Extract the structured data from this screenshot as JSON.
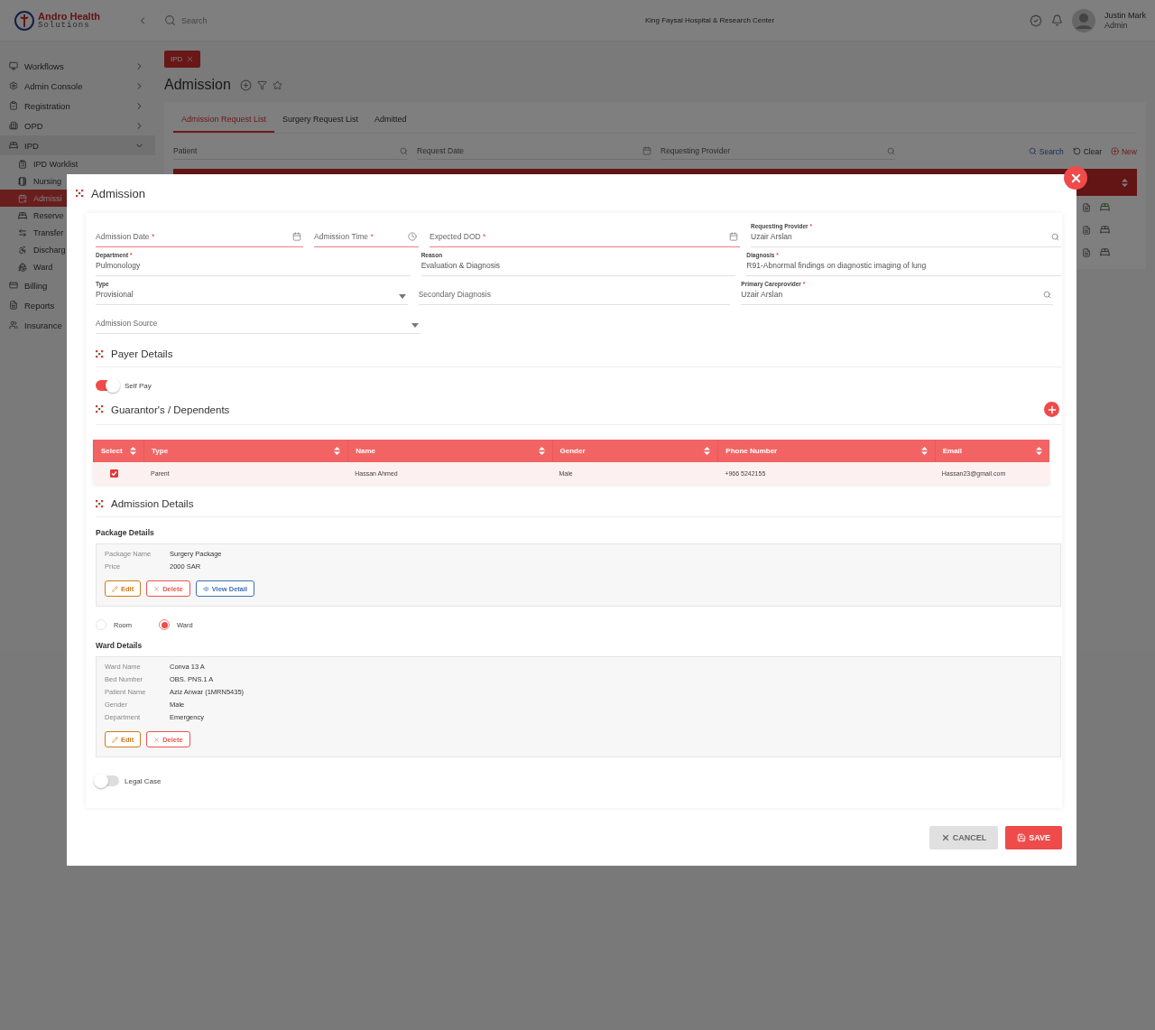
{
  "header": {
    "logo": {
      "name": "Andro Health",
      "tagline": "Solutions"
    },
    "search": {
      "placeholder": "Search"
    },
    "organization": "King Faysal Hospital & Research Center",
    "user": {
      "name": "Justin Mark",
      "role": "Admin"
    }
  },
  "sidebar": {
    "items": [
      {
        "label": "Workflows",
        "kind": "group",
        "expanded": false
      },
      {
        "label": "Admin Console",
        "kind": "group",
        "expanded": false
      },
      {
        "label": "Registration",
        "kind": "group",
        "expanded": false
      },
      {
        "label": "OPD",
        "kind": "group",
        "expanded": false
      },
      {
        "label": "IPD",
        "kind": "group",
        "expanded": true,
        "children": [
          {
            "label": "IPD Worklist",
            "selected": false
          },
          {
            "label": "Nursing",
            "selected": false
          },
          {
            "label": "Admissi",
            "selected": true
          },
          {
            "label": "Reserve",
            "selected": false
          },
          {
            "label": "Transfer",
            "selected": false
          },
          {
            "label": "Discharg",
            "selected": false
          },
          {
            "label": "Ward",
            "selected": false
          }
        ]
      },
      {
        "label": "Billing",
        "kind": "link"
      },
      {
        "label": "Reports",
        "kind": "link"
      },
      {
        "label": "Insurance",
        "kind": "link"
      }
    ]
  },
  "breadcrumb": {
    "label": "IPD"
  },
  "page_title": "Admission",
  "tabs": [
    {
      "label": "Admission Request List",
      "selected": true
    },
    {
      "label": "Surgery Request List",
      "selected": false
    },
    {
      "label": "Admitted",
      "selected": false
    }
  ],
  "filters": [
    {
      "placeholder": "Patient",
      "kind": "lookup"
    },
    {
      "placeholder": "Request Date",
      "kind": "date"
    },
    {
      "placeholder": "Requesting Provider",
      "kind": "lookup"
    }
  ],
  "filter_actions": [
    {
      "label": "Search",
      "kind": "search"
    },
    {
      "label": "Clear",
      "kind": "clear"
    },
    {
      "label": "New",
      "kind": "new"
    }
  ],
  "modal": {
    "title": "Admission",
    "field_rows": [
      [
        {
          "label": "Admission Date",
          "required_mark": "*",
          "kind": "date"
        },
        {
          "label": "Admission Time",
          "required_mark": "*",
          "kind": "time"
        },
        {
          "label": "Expected DOD",
          "required_mark": "*",
          "kind": "date"
        },
        {
          "label": "Requesting Provider",
          "required_mark": "*",
          "kind": "lookup",
          "value": "Uzair Arslan"
        }
      ],
      [
        {
          "label": "Department",
          "required_mark": "*",
          "kind": "text",
          "value": "Pulmonology"
        },
        {
          "label": "Reason",
          "kind": "text",
          "value": "Evaluation & Diagnosis"
        },
        {
          "label": "Diagnosis",
          "required_mark": "*",
          "kind": "text",
          "value": "R91-Abnormal findings on diagnostic imaging of lung"
        }
      ],
      [
        {
          "label": "Type",
          "kind": "select",
          "value": "Provisional"
        },
        {
          "label": "Secondary Diagnosis",
          "kind": "text"
        },
        {
          "label": "Primary Careprovider",
          "required_mark": "*",
          "kind": "lookup",
          "value": "Uzair Arslan"
        }
      ],
      [
        {
          "label": "Admission Source",
          "kind": "select"
        }
      ]
    ],
    "payer": {
      "title": "Payer Details",
      "self_pay": {
        "label": "Self Pay",
        "on": true
      }
    },
    "guarantors": {
      "title": "Guarantor's / Dependents",
      "columns": [
        "Select",
        "Type",
        "Name",
        "Gender",
        "Phone Number",
        "Email"
      ],
      "rows": [
        {
          "checked": true,
          "cells": [
            "",
            "Parent",
            "Hassan Ahmed",
            "Male",
            "+966 5242155",
            "Hassan23@gmail.com"
          ]
        }
      ]
    },
    "admission_details": {
      "title": "Admission Details",
      "package": {
        "heading": "Package Details",
        "fields": [
          {
            "label": "Package Name",
            "value": "Surgery Package"
          },
          {
            "label": "Price",
            "value": "2000 SAR"
          }
        ],
        "actions": [
          {
            "label": "Edit",
            "kind": "edit"
          },
          {
            "label": "Delete",
            "kind": "delete"
          },
          {
            "label": "View Detail",
            "kind": "view"
          }
        ]
      },
      "accommodation": [
        {
          "label": "Room",
          "selected": false
        },
        {
          "label": "Ward",
          "selected": true
        }
      ],
      "ward": {
        "heading": "Ward Details",
        "fields": [
          {
            "label": "Ward Name",
            "value": "Conva 13 A"
          },
          {
            "label": "Bed Number",
            "value": "OBS. PNS.1 A"
          },
          {
            "label": "Patient Name",
            "value": "Aziz Anwar (1MRN5435)"
          },
          {
            "label": "Gender",
            "value": "Male"
          },
          {
            "label": "Department",
            "value": "Emergency"
          }
        ],
        "actions": [
          {
            "label": "Edit",
            "kind": "edit"
          },
          {
            "label": "Delete",
            "kind": "delete"
          }
        ]
      },
      "legal_case": {
        "label": "Legal Case",
        "on": false
      }
    },
    "buttons": [
      {
        "label": "CANCEL",
        "kind": "cancel"
      },
      {
        "label": "SAVE",
        "kind": "save"
      }
    ]
  }
}
